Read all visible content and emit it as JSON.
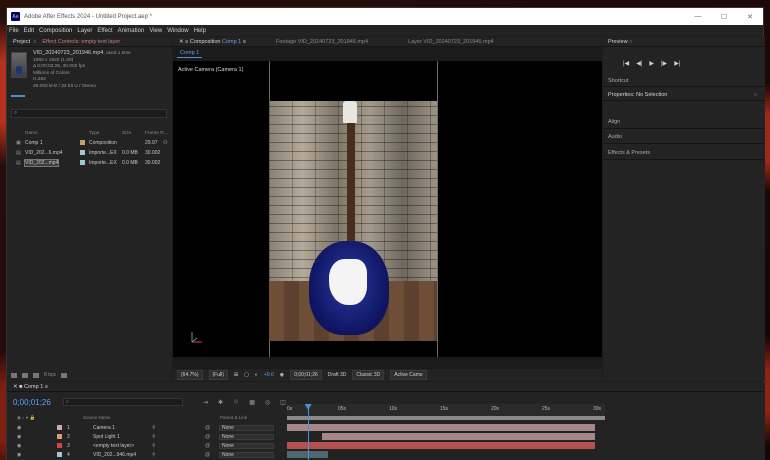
{
  "window": {
    "title": "Adobe After Effects 2024 - Untitled Project.aep *",
    "logo": "Ae",
    "controls": [
      "—",
      "☐",
      "✕"
    ]
  },
  "menu": [
    "File",
    "Edit",
    "Composition",
    "Layer",
    "Effect",
    "Animation",
    "View",
    "Window",
    "Help"
  ],
  "project_panel": {
    "tab_project": "Project",
    "tab_effects": "Effect Controls: empty text layer",
    "file_name": "VID_20240723_201946.mp4",
    "file_used": ", used 1 time",
    "file_info": [
      "1080 x 1920 (1.00)",
      "Δ 0;00;02;26, 30.002 fps",
      "Millions of Colors",
      "H.264",
      "48.000 kHz / 32 bit U / Stereo"
    ],
    "search_icon": "⌕",
    "columns": [
      "Name",
      "Type",
      "Size",
      "Frame R..."
    ],
    "items": [
      {
        "name": "Comp 1",
        "type": "Composition",
        "size": "",
        "fps": "29.97",
        "color": "#c2a16b"
      },
      {
        "name": "VID_202...6.mp4",
        "type": "Importe...EX",
        "size": "0.0 MB",
        "fps": "30.002",
        "color": "#9ec8d6"
      },
      {
        "name": "VID_202...mp4",
        "type": "Importe...EX",
        "size": "0.0 MB",
        "fps": "30.002",
        "color": "#9ec8d6"
      }
    ],
    "bpc": "8 bpc"
  },
  "comp_panel": {
    "tab_comp": "Composition",
    "tab_comp_name": "Comp 1",
    "tab_footage": "Footage  VID_20240723_201946.mp4",
    "tab_layer": "Layer  VID_20240723_201946.mp4",
    "subtab": "Comp 1",
    "camera_label": "Active Camera (Camera 1)",
    "zoom": "(64.7%)",
    "resolution": "(Full)",
    "exposure": "+0.0",
    "timecode": "0;00;01;26",
    "draft": "Draft 3D",
    "renderer": "Classic 3D",
    "view": "Active Came"
  },
  "right_panel": {
    "preview": "Preview",
    "controls": [
      "|◀",
      "◀|",
      "▶",
      "|▶",
      "▶|"
    ],
    "shortcut": "Shortcut",
    "properties": "Properties: No Selection",
    "align": "Align",
    "audio": "Audio",
    "effects": "Effects & Presets"
  },
  "timeline": {
    "comp_tab": "Comp 1",
    "timecode": "0;00;01;26",
    "search_icon": "⌕",
    "col_source": "Source Name",
    "col_parent": "Parent & Link",
    "ruler": [
      "0s",
      "05s",
      "10s",
      "15s",
      "20s",
      "25s",
      "30s"
    ],
    "playhead_fraction": 0.065,
    "layers": [
      {
        "num": "1",
        "name": "Camera 1",
        "parent": "None",
        "label_color": "#d3a7a7",
        "bar_color": "#a58888",
        "bar_start": 0.0,
        "bar_end": 0.97
      },
      {
        "num": "2",
        "name": "Spot Light 1",
        "parent": "None",
        "label_color": "#d8a070",
        "bar_color": "#a58888",
        "bar_start": 0.11,
        "bar_end": 0.97
      },
      {
        "num": "3",
        "name": "<empty text layer>",
        "parent": "None",
        "label_color": "#d04848",
        "bar_color": "#b35050",
        "bar_start": 0.0,
        "bar_end": 0.97
      },
      {
        "num": "4",
        "name": "VID_202...946.mp4",
        "parent": "None",
        "label_color": "#9ec8d6",
        "bar_color": "#4f6870",
        "bar_start": 0.0,
        "bar_end": 0.13
      }
    ]
  }
}
